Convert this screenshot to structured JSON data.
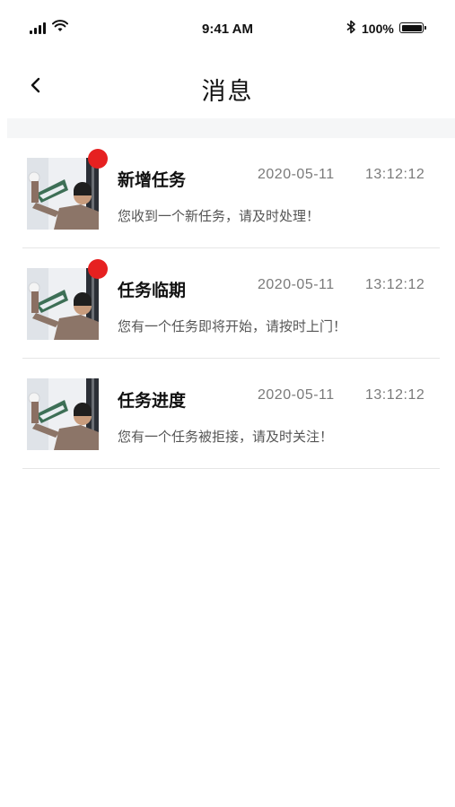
{
  "status_bar": {
    "time": "9:41 AM",
    "battery": "100%"
  },
  "nav": {
    "title": "消息",
    "back_icon": "chevron-left-icon"
  },
  "messages": [
    {
      "title": "新增任务",
      "date": "2020-05-11",
      "time": "13:12:12",
      "desc": "您收到一个新任务，请及时处理！",
      "unread": true
    },
    {
      "title": "任务临期",
      "date": "2020-05-11",
      "time": "13:12:12",
      "desc": "您有一个任务即将开始，请按时上门！",
      "unread": true
    },
    {
      "title": "任务进度",
      "date": "2020-05-11",
      "time": "13:12:12",
      "desc": "您有一个任务被拒接，请及时关注！",
      "unread": false
    }
  ],
  "colors": {
    "unread_dot": "#e62020",
    "separator_band": "#f5f6f7"
  }
}
